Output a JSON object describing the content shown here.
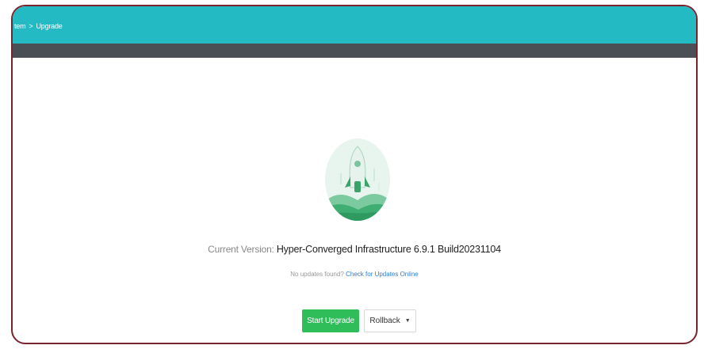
{
  "breadcrumb": {
    "parent": "tem",
    "separator": ">",
    "current": "Upgrade"
  },
  "version": {
    "label": "Current Version:",
    "value": "Hyper-Converged Infrastructure 6.9.1 Build20231104"
  },
  "updates": {
    "message": "No updates found?",
    "link": "Check for Updates Online"
  },
  "actions": {
    "start_upgrade": "Start Upgrade",
    "rollback": "Rollback",
    "rollback_caret": "▼"
  },
  "colors": {
    "header": "#24bac4",
    "subheader": "#4a4f55",
    "primary_button": "#2ebd58",
    "link": "#2b7fd0",
    "frame_border": "#7a2430"
  },
  "icons": {
    "illustration": "rocket-launch-illustration"
  }
}
